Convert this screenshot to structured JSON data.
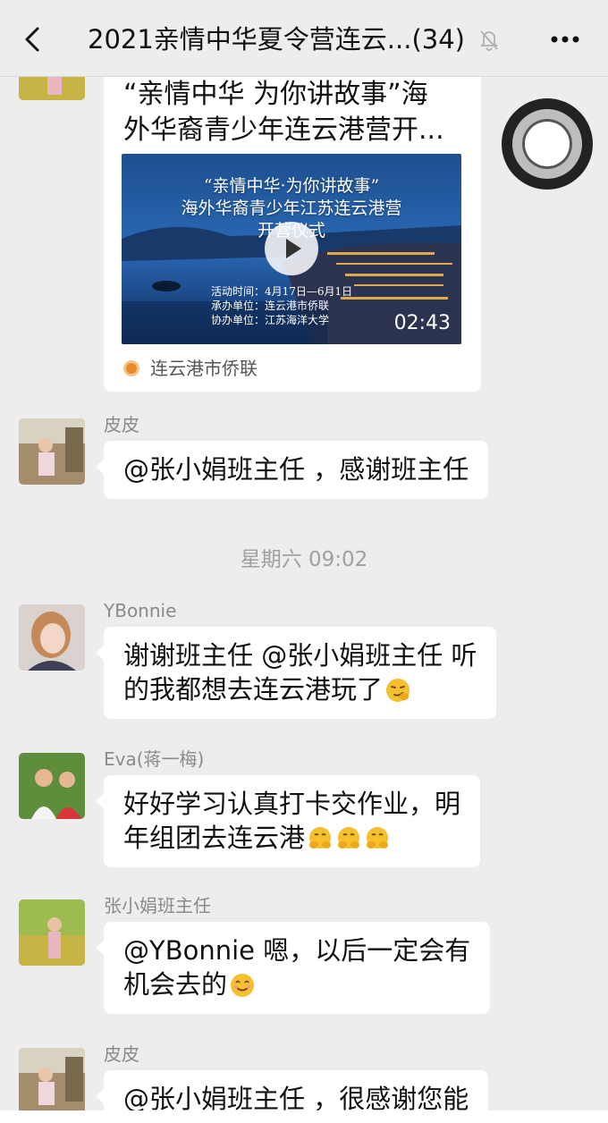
{
  "header": {
    "title": "2021亲情中华夏令营连云...",
    "member_count": "(34)"
  },
  "shared_video": {
    "title": "“亲情中华 为你讲故事”海\n外华裔青少年连云港营开...",
    "thumbnail_title": "“亲情中华·为你讲故事”\n海外华裔青少年江苏连云港营\n开营仪式",
    "thumbnail_info": "活动时间：4月17日—6月1日\n承办单位：连云港市侨联\n协办单位：江苏海洋大学",
    "duration": "02:43",
    "source": "连云港市侨联"
  },
  "timestamp": "星期六 09:02",
  "messages": [
    {
      "sender": "皮皮",
      "text": "@张小娟班主任 ，感谢班主任"
    },
    {
      "sender": "YBonnie",
      "text": "谢谢班主任 @张小娟班主任 听\n的我都想去连云港玩了"
    },
    {
      "sender": "Eva(蒋一梅)",
      "text": "好好学习认真打卡交作业，明\n年组团去连云港"
    },
    {
      "sender": "张小娟班主任",
      "text": "@YBonnie 嗯，以后一定会有\n机会去的"
    },
    {
      "sender": "皮皮",
      "text": "@张小娟班主任 ，很感谢您能"
    }
  ],
  "colors": {
    "background": "#ededed",
    "bubble": "#ffffff",
    "muted_text": "#8a8a8a",
    "emoji": "#f5c02e"
  },
  "icons": [
    "back-icon",
    "mute-bell-icon",
    "more-icon",
    "play-icon",
    "smirk-emoji",
    "hug-emoji",
    "smile-emoji",
    "floating-window-icon"
  ]
}
